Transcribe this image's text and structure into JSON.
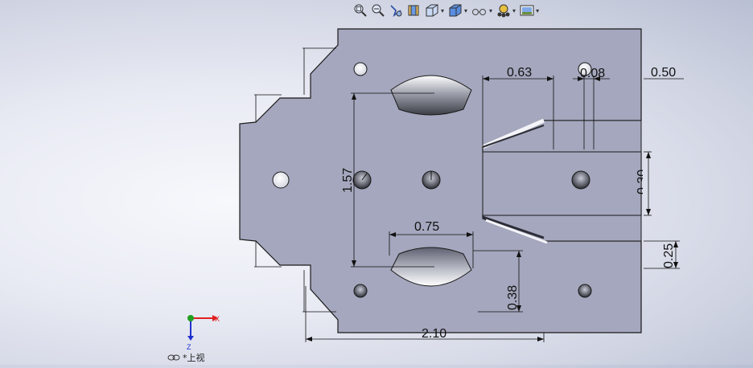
{
  "toolbar": {
    "items": [
      {
        "icon": "zoom-to-fit-icon"
      },
      {
        "icon": "zoom-to-area-icon"
      },
      {
        "icon": "previous-view-icon"
      },
      {
        "icon": "section-view-icon"
      },
      {
        "icon": "view-orientation-icon",
        "dropdown": true
      },
      {
        "icon": "display-style-icon",
        "dropdown": true
      },
      {
        "icon": "hide-show-items-icon",
        "dropdown": true
      },
      {
        "icon": "edit-appearance-icon",
        "dropdown": true
      },
      {
        "icon": "apply-scene-icon",
        "dropdown": true
      }
    ]
  },
  "dimensions": {
    "d063": "0.63",
    "d008": "0.08",
    "d050": "0.50",
    "d157": "1.57",
    "d075": "0.75",
    "d038": "0.38",
    "d025": "0.25",
    "d210": "2.10",
    "d030": "0.30"
  },
  "triad": {
    "x_label": "X",
    "z_label": "Z"
  },
  "view": {
    "name": "*上视"
  },
  "colors": {
    "part_face": "#a4a7bd",
    "part_edge": "#1a1a1a",
    "triad_x": "#e02020",
    "triad_y": "#20a020",
    "triad_z": "#2030d0"
  }
}
